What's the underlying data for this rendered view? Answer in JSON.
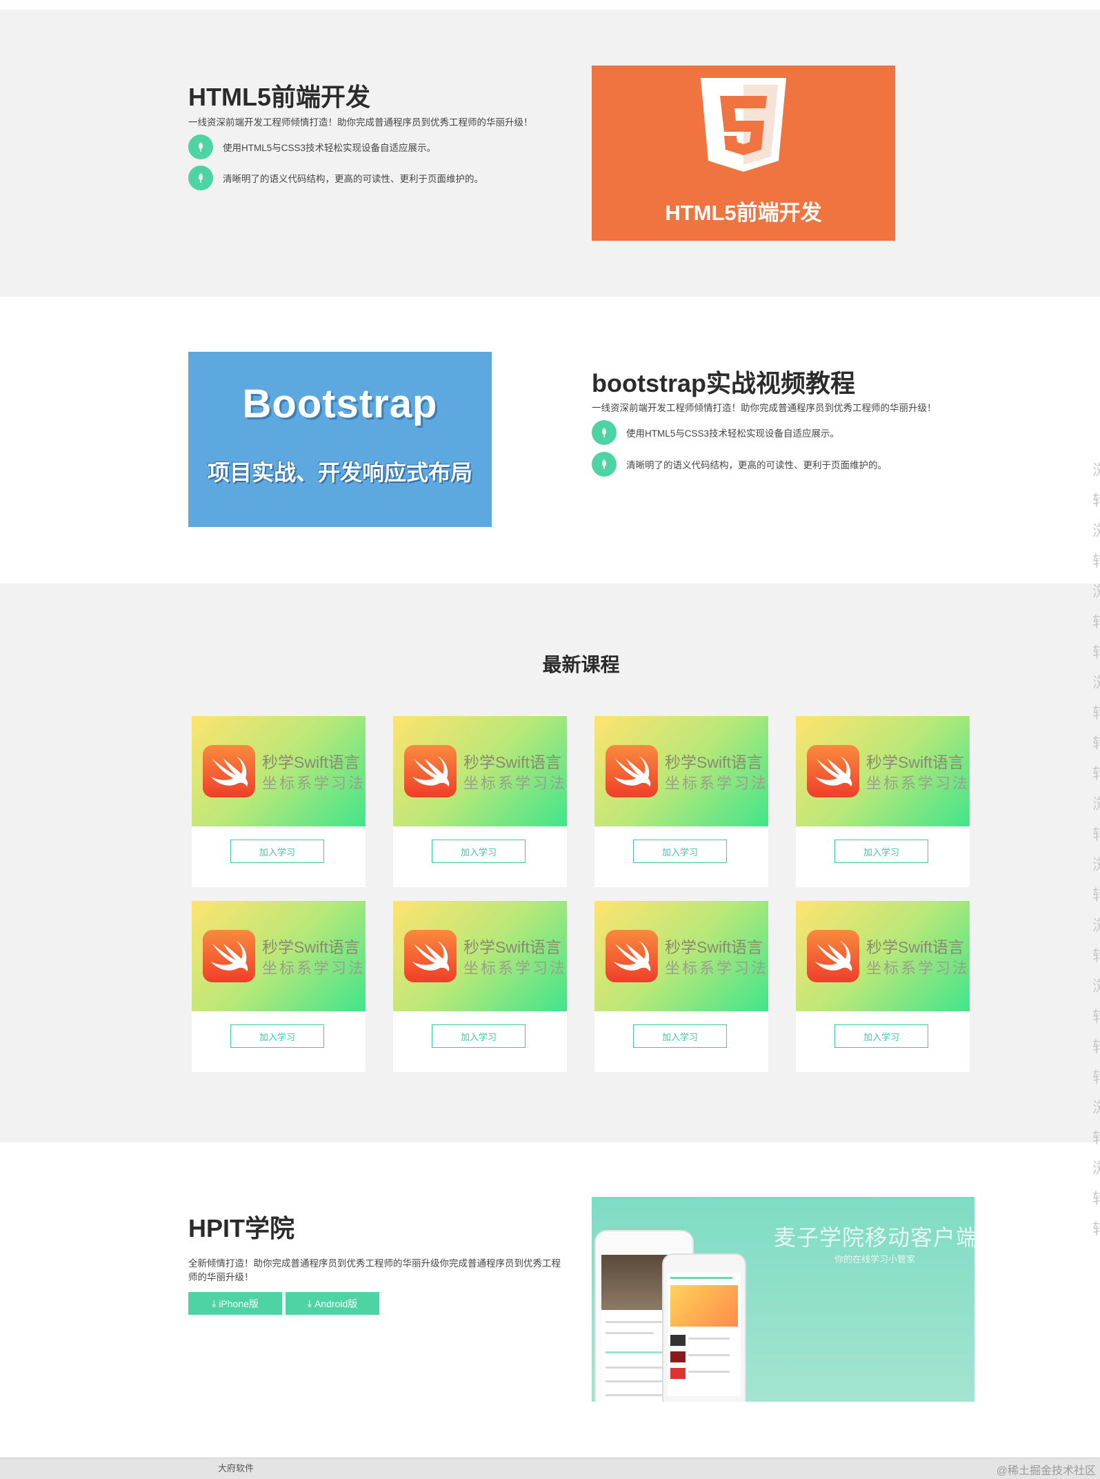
{
  "html5_section": {
    "title": "HTML5前端开发",
    "description": "一线资深前端开发工程师倾情打造！助你完成普通程序员到优秀工程师的华丽升级！",
    "bullets": [
      "使用HTML5与CSS3技术轻松实现设备自适应展示。",
      "清晰明了的语义代码结构，更高的可读性、更利于页面维护的。"
    ],
    "image_caption": "HTML5前端开发"
  },
  "bootstrap_section": {
    "title": "bootstrap实战视频教程",
    "description": "一线资深前端开发工程师倾情打造！助你完成普通程序员到优秀工程师的华丽升级！",
    "bullets": [
      "使用HTML5与CSS3技术轻松实现设备自适应展示。",
      "清晰明了的语义代码结构，更高的可读性、更利于页面维护的。"
    ],
    "image_title": "Bootstrap",
    "image_subtitle": "项目实战、开发响应式布局"
  },
  "latest_courses": {
    "title": "最新课程",
    "courses": [
      {
        "title": "秒学Swift语言",
        "subtitle": "坐标系学习法",
        "button": "加入学习"
      },
      {
        "title": "秒学Swift语言",
        "subtitle": "坐标系学习法",
        "button": "加入学习"
      },
      {
        "title": "秒学Swift语言",
        "subtitle": "坐标系学习法",
        "button": "加入学习"
      },
      {
        "title": "秒学Swift语言",
        "subtitle": "坐标系学习法",
        "button": "加入学习"
      },
      {
        "title": "秒学Swift语言",
        "subtitle": "坐标系学习法",
        "button": "加入学习"
      },
      {
        "title": "秒学Swift语言",
        "subtitle": "坐标系学习法",
        "button": "加入学习"
      },
      {
        "title": "秒学Swift语言",
        "subtitle": "坐标系学习法",
        "button": "加入学习"
      },
      {
        "title": "秒学Swift语言",
        "subtitle": "坐标系学习法",
        "button": "加入学习"
      }
    ]
  },
  "hpit_section": {
    "title": "HPIT学院",
    "description": "全新倾情打造！助你完成普通程序员到优秀工程师的华丽升级你完成普通程序员到优秀工程师的华丽升级！",
    "buttons": [
      "iPhone版",
      "Android版"
    ],
    "image_title": "麦子学院移动客户端",
    "image_subtitle": "你的在线学习小管家"
  },
  "taskbar": {
    "app_label": "大府软件",
    "watermark": "@稀土掘金技术社区"
  },
  "colors": {
    "accent": "#4ed3a4",
    "html5_orange": "#ef7440",
    "bootstrap_blue": "#5da8df",
    "section_gray": "#f2f2f2"
  }
}
